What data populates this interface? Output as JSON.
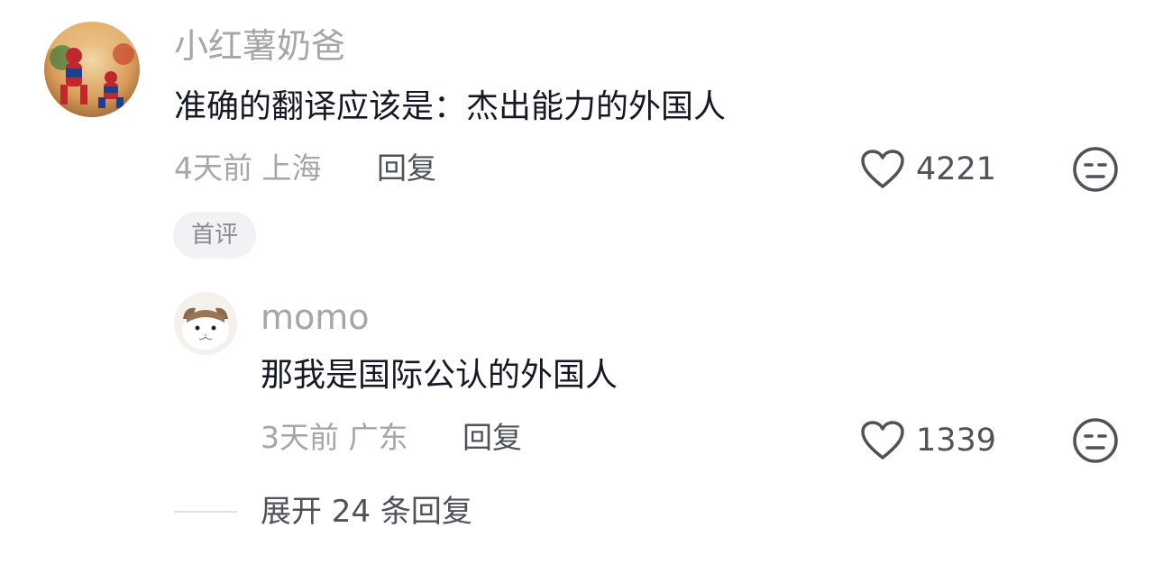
{
  "comment": {
    "username": "小红薯奶爸",
    "text": "准确的翻译应该是：杰出能力的外国人",
    "time_location": "4天前 上海",
    "reply_label": "回复",
    "like_count": "4221",
    "tag": "首评"
  },
  "reply": {
    "username": "momo",
    "text": "那我是国际公认的外国人",
    "time_location": "3天前 广东",
    "reply_label": "回复",
    "like_count": "1339"
  },
  "expand_label": "展开 24 条回复",
  "icons": {
    "like": "heart-outline-icon",
    "dislike": "meh-face-icon"
  },
  "colors": {
    "secondary_text": "#a6a6aa",
    "primary_text": "#161823",
    "action_text": "#505259",
    "pill_bg": "#f2f2f4"
  }
}
